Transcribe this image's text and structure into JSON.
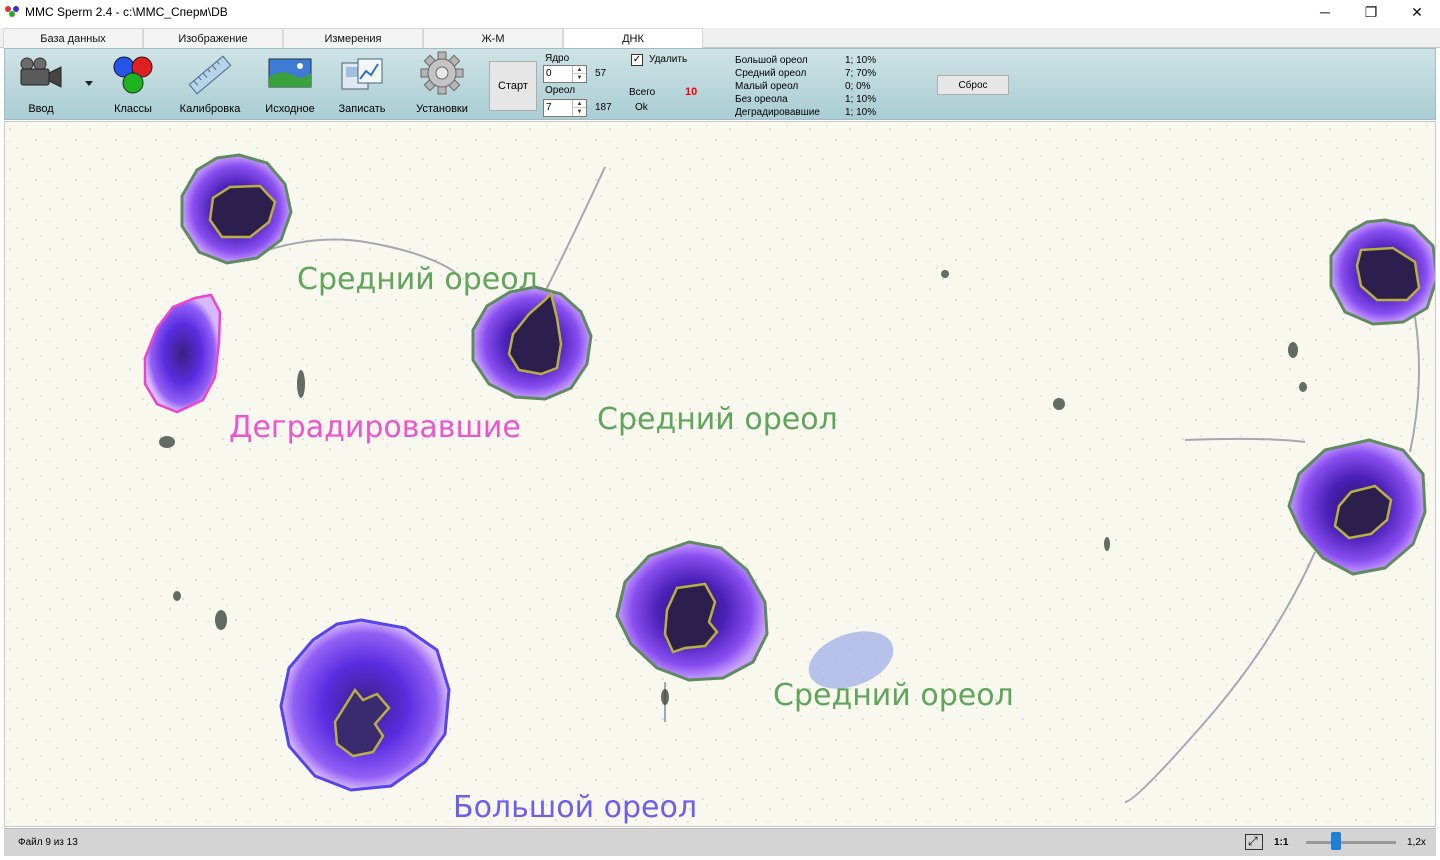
{
  "window": {
    "title": "MMC Sperm 2.4 - c:\\MMC_Сперм\\DB",
    "minimize": "─",
    "restore": "❐",
    "close": "✕"
  },
  "tabs": [
    "База данных",
    "Изображение",
    "Измерения",
    "Ж-М",
    "ДНК"
  ],
  "active_tab": "ДНК",
  "toolbar": {
    "input_label": "Ввод",
    "classes_label": "Классы",
    "calibration_label": "Калибровка",
    "source_label": "Исходное",
    "record_label": "Записать",
    "settings_label": "Установки",
    "start_label": "Старт",
    "nucleus_label": "Ядро",
    "nucleus_value": "0",
    "nucleus_result": "57",
    "halo_label": "Ореол",
    "halo_value": "7",
    "halo_result": "187",
    "delete_label": "Удалить",
    "delete_checked": true,
    "total_label": "Всего",
    "total_value": "10",
    "ok_label": "Ok",
    "reset_label": "Сброс"
  },
  "stats": [
    {
      "label": "Большой ореол",
      "value": "1; 10%"
    },
    {
      "label": "Средний ореол",
      "value": "7; 70%"
    },
    {
      "label": "Малый ореол",
      "value": "0; 0%"
    },
    {
      "label": "Без ореола",
      "value": "1; 10%"
    },
    {
      "label": "Деградировавшие",
      "value": "1; 10%"
    }
  ],
  "cell_labels": [
    {
      "text": "Средний ореол",
      "color": "#5fa55a"
    },
    {
      "text": "Средний ореол",
      "color": "#5fa55a"
    },
    {
      "text": "Средний ореол",
      "color": "#5fa55a"
    },
    {
      "text": "Деградировавшие",
      "color": "#ee55cc"
    },
    {
      "text": "Большой ореол",
      "color": "#6f5cf0"
    }
  ],
  "colors": {
    "medium_halo": "#5f8a5f",
    "degraded": "#ee44cc",
    "large_halo": "#5544ee",
    "nucleus_outline": "#b8b040",
    "total_value": "#ff0000"
  },
  "status": {
    "file_text": "Файл 9 из 13",
    "zoom_one": "1:1",
    "zoom_value": "1,2x"
  }
}
